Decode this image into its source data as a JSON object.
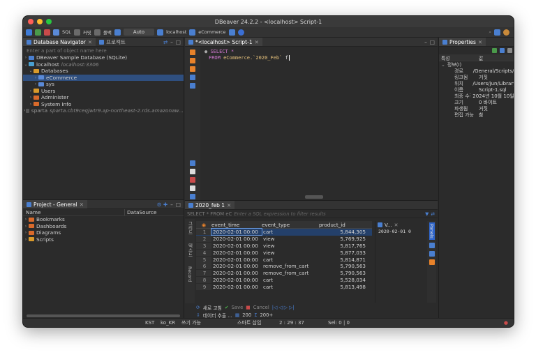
{
  "window": {
    "title": "DBeaver 24.2.2 - <localhost> Script-1"
  },
  "toolbar": {
    "sql_label": "SQL",
    "commit_label": "커밋",
    "rollback_label": "롤백",
    "mode_value": "Auto",
    "connection": "localhost",
    "schema": "eCommerce"
  },
  "navigator": {
    "tab_label": "Database Navigator",
    "tab2_label": "프로젝트",
    "filter_placeholder": "Enter a part of object name here",
    "items": [
      {
        "label": "DBeaver Sample Database (SQLite)"
      },
      {
        "label": "localhost",
        "detail": "localhost:3306"
      },
      {
        "label": "Databases"
      },
      {
        "label": "eCommerce"
      },
      {
        "label": "sys"
      },
      {
        "label": "Users"
      },
      {
        "label": "Administer"
      },
      {
        "label": "System Info"
      },
      {
        "label": "sparta",
        "detail": "sparta.cbt9ceqjwtr9.ap-northeast-2.rds.amazonaw..."
      }
    ]
  },
  "project": {
    "tab_label": "Project - General",
    "col_name": "Name",
    "col_datasource": "DataSource",
    "items": [
      "Bookmarks",
      "Dashboards",
      "Diagrams",
      "Scripts"
    ]
  },
  "editor": {
    "tab_label": "*<localhost> Script-1",
    "line1": "SELECT *",
    "line2_kw": "FROM",
    "line2_obj": "eCommerce.`2020_Feb`",
    "line2_alias": "f"
  },
  "results": {
    "tab_label": "2020_feb 1",
    "filter_prefix": "SELECT * FROM eC",
    "filter_placeholder": "Enter a SQL expression to filter results",
    "columns": [
      "event_time",
      "event_type",
      "product_id"
    ],
    "rows": [
      {
        "n": "1",
        "time": "2020-02-01 00:00",
        "type": "cart",
        "pid": "5,844,305"
      },
      {
        "n": "2",
        "time": "2020-02-01 00:00",
        "type": "view",
        "pid": "5,769,925"
      },
      {
        "n": "3",
        "time": "2020-02-01 00:00",
        "type": "view",
        "pid": "5,817,765"
      },
      {
        "n": "4",
        "time": "2020-02-01 00:00",
        "type": "view",
        "pid": "5,877,033"
      },
      {
        "n": "5",
        "time": "2020-02-01 00:00",
        "type": "cart",
        "pid": "5,814,871"
      },
      {
        "n": "6",
        "time": "2020-02-01 00:00",
        "type": "remove_from_cart",
        "pid": "5,790,563"
      },
      {
        "n": "7",
        "time": "2020-02-01 00:00",
        "type": "remove_from_cart",
        "pid": "5,790,563"
      },
      {
        "n": "8",
        "time": "2020-02-01 00:00",
        "type": "cart",
        "pid": "5,528,034"
      },
      {
        "n": "9",
        "time": "2020-02-01 00:00",
        "type": "cart",
        "pid": "5,813,498"
      }
    ],
    "value_panel_label": "V...",
    "value_panel_value": "2020-02-01 0",
    "panels_label": "Panels",
    "grid_label": "그리드",
    "text_label": "텍스트",
    "record_label": "Record",
    "refresh_label": "새로 고침",
    "save_label": "Save",
    "cancel_label": "Cancel",
    "export_label": "데이터 추출 ...",
    "fetch_size": "200",
    "row_count": "200+"
  },
  "properties": {
    "tab_label": "Properties",
    "col_key": "특성",
    "col_value": "값",
    "group_label": "정보(I)",
    "rows": [
      {
        "k": "경로",
        "v": "/General/Scripts/Script-"
      },
      {
        "k": "링크됨",
        "v": "거짓"
      },
      {
        "k": "위치",
        "v": "/Users/jun/Library/DBea"
      },
      {
        "k": "이름",
        "v": "Script-1.sql"
      },
      {
        "k": "최종 수정 날",
        "v": "2024년 10월 10일 오전 7:"
      },
      {
        "k": "크기",
        "v": "0 바이트"
      },
      {
        "k": "파생됨",
        "v": "거짓"
      },
      {
        "k": "편집 가능",
        "v": "참"
      }
    ]
  },
  "status": {
    "timezone": "KST",
    "locale": "ko_KR",
    "mode": "쓰기 가능",
    "insert": "스마트 삽입",
    "position": "2 : 29 : 37",
    "selection": "Sel: 0 | 0"
  },
  "colors": {
    "accent": "#2f65ca",
    "keyword": "#d279d2",
    "string": "#e5c07b",
    "window_bg": "#2b2b2b"
  }
}
